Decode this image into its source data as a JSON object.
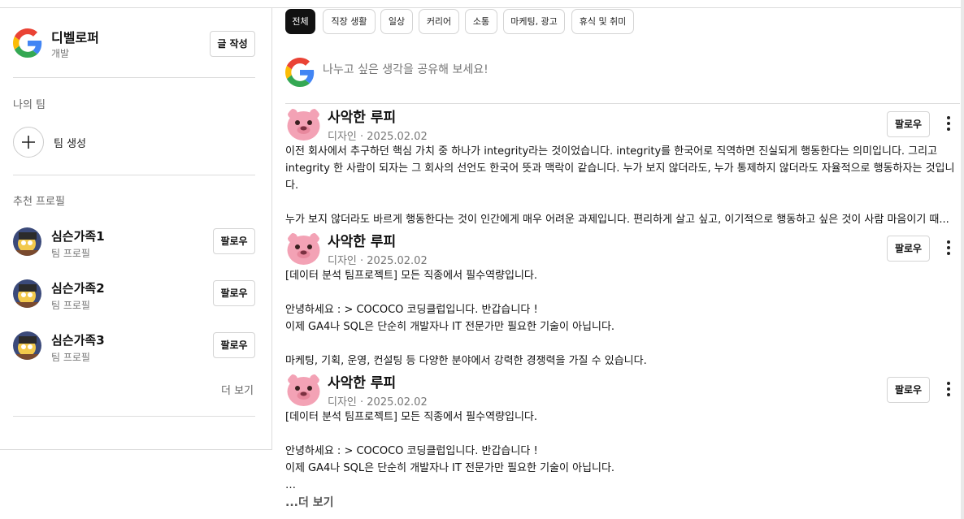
{
  "sidebar": {
    "profile": {
      "name": "디벨로퍼",
      "role": "개발",
      "write_label": "글 작성"
    },
    "my_team": {
      "title": "나의 팀",
      "create_label": "팀 생성"
    },
    "recommended": {
      "title": "추천 프로필",
      "items": [
        {
          "name": "심슨가족1",
          "subtitle": "팀 프로필",
          "follow_label": "팔로우"
        },
        {
          "name": "심슨가족2",
          "subtitle": "팀 프로필",
          "follow_label": "팔로우"
        },
        {
          "name": "심슨가족3",
          "subtitle": "팀 프로필",
          "follow_label": "팔로우"
        }
      ],
      "more_label": "더 보기"
    }
  },
  "tabs": [
    "전체",
    "직장 생활",
    "일상",
    "커리어",
    "소통",
    "마케팅, 광고",
    "휴식 및 취미"
  ],
  "active_tab": "전체",
  "composer": {
    "placeholder": "나누고 싶은 생각을 공유해 보세요!"
  },
  "posts": [
    {
      "author": "사악한 루피",
      "meta": "디자인 · 2025.02.02",
      "follow_label": "팔로우",
      "body": "이전 회사에서 추구하던 핵심 가치 중 하나가 integrity라는 것이었습니다. integrity를 한국어로 직역하면 진실되게 행동한다는 의미입니다. 그리고 integrity 한 사람이 되자는 그 회사의 선언도 한국어 뜻과 맥락이 같습니다. 누가 보지 않더라도, 누가 통제하지 않더라도 자율적으로 행동하자는 것입니다.\n\n누가 보지 않더라도 바르게 행동한다는 것이 인간에게 매우 어려운 과제입니다. 편리하게 살고 싶고, 이기적으로 행동하고 싶은 것이 사람 마음이기 때..."
    },
    {
      "author": "사악한 루피",
      "meta": "디자인 · 2025.02.02",
      "follow_label": "팔로우",
      "body": "[데이터 분석 팀프로젝트] 모든 직종에서 필수역량입니다.\n\n안녕하세요 : > COCOCO 코딩클럽입니다. 반갑습니다 !\n이제 GA4나 SQL은 단순히 개발자나 IT 전문가만 필요한 기술이 아닙니다.\n\n마케팅, 기획, 운영, 컨설팅 등 다양한 분야에서 강력한 경쟁력을 가질 수 있습니다."
    },
    {
      "author": "사악한 루피",
      "meta": "디자인 · 2025.02.02",
      "follow_label": "팔로우",
      "body": "[데이터 분석 팀프로젝트] 모든 직종에서 필수역량입니다.\n\n안녕하세요 : > COCOCO 코딩클럽입니다. 반갑습니다 !\n이제 GA4나 SQL은 단순히 개발자나 IT 전문가만 필요한 기술이 아닙니다.\n…",
      "read_more_label": "...더 보기"
    }
  ]
}
